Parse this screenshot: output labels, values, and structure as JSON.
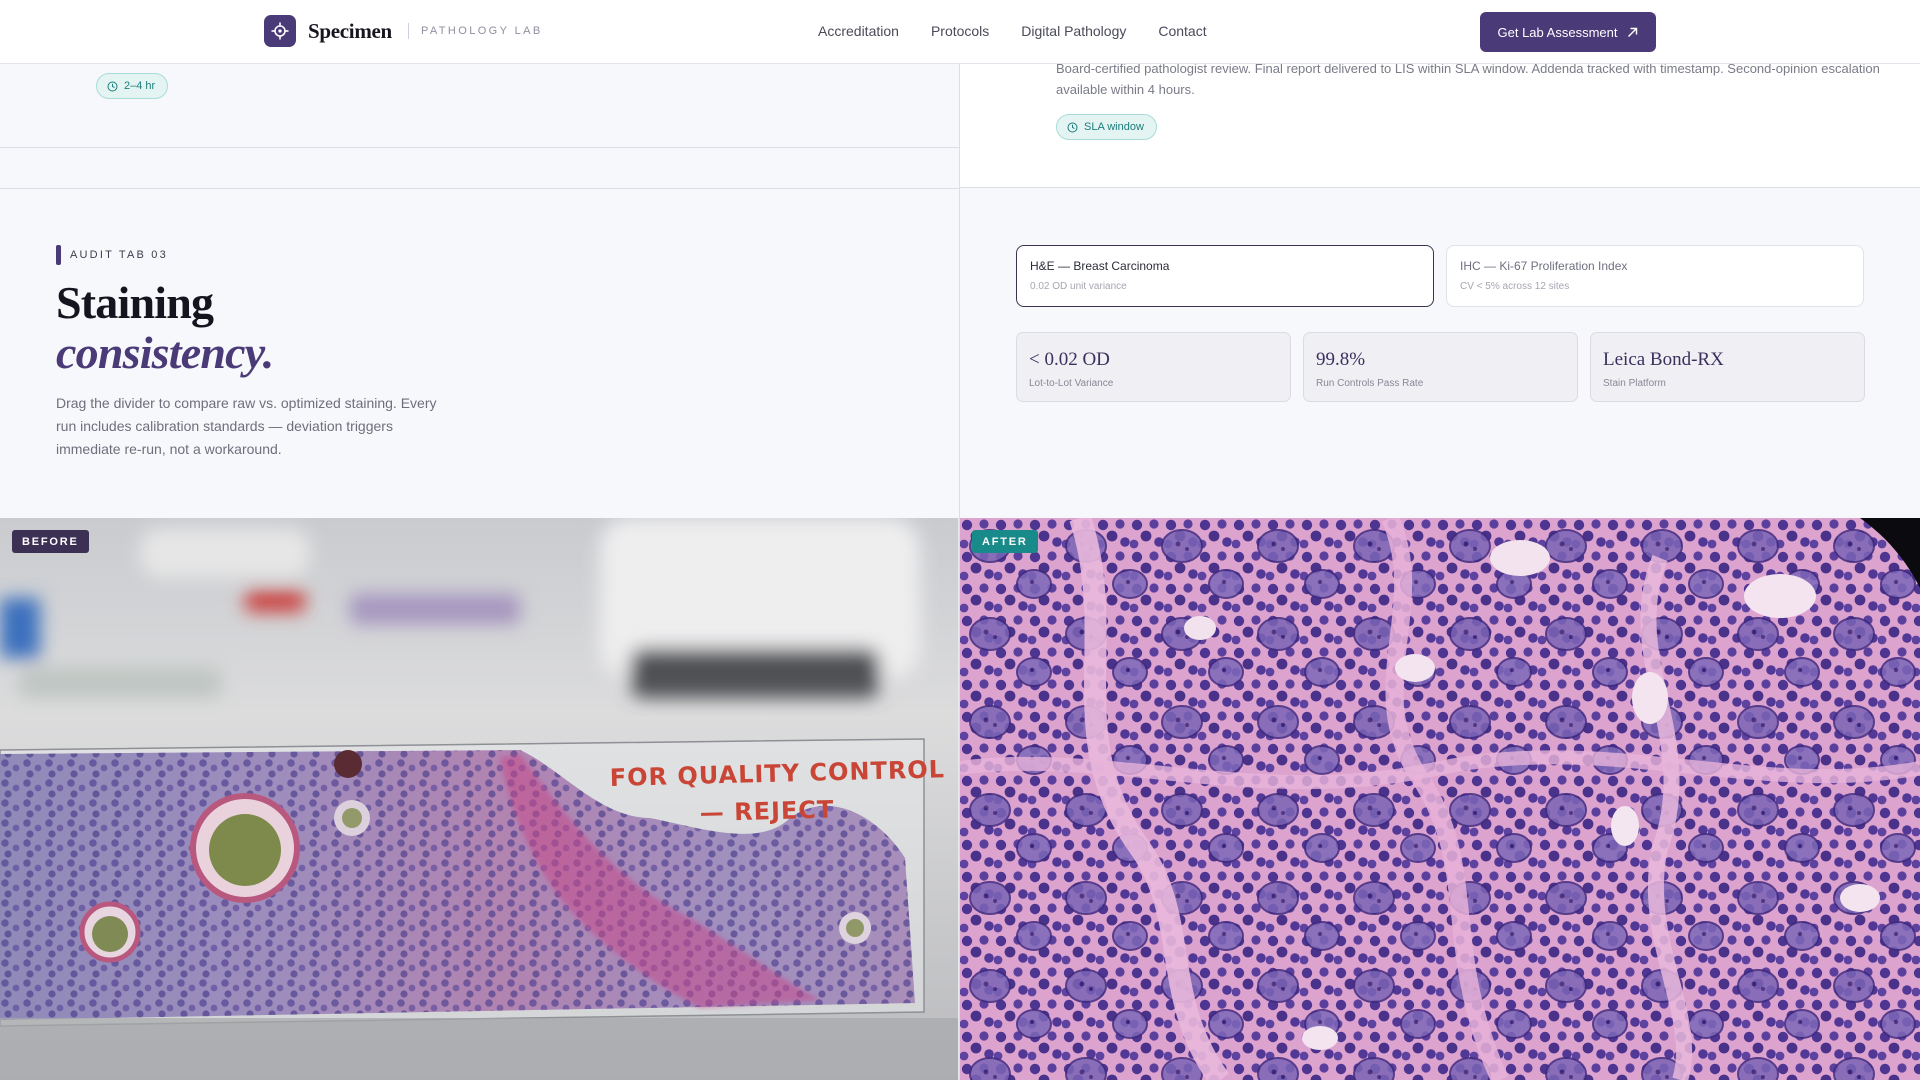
{
  "header": {
    "brand_name": "Specimen",
    "brand_sub": "PATHOLOGY LAB",
    "nav": [
      "Accreditation",
      "Protocols",
      "Digital Pathology",
      "Contact"
    ],
    "cta_label": "Get Lab Assessment"
  },
  "top": {
    "left_pill": "2–4 hr",
    "review_text": "Board-certified pathologist review. Final report delivered to LIS within SLA window. Addenda tracked with timestamp. Second-opinion escalation available within 4 hours.",
    "right_pill": "SLA window"
  },
  "section": {
    "eyebrow": "AUDIT TAB 03",
    "title_line1": "Staining",
    "title_line2": "consistency.",
    "description": "Drag the divider to compare raw vs. optimized staining. Every run includes calibration standards — deviation triggers immediate re-run, not a workaround."
  },
  "tabs": [
    {
      "title": "H&E — Breast Carcinoma",
      "sub": "0.02 OD unit variance",
      "active": true
    },
    {
      "title": "IHC — Ki-67 Proliferation Index",
      "sub": "CV < 5% across 12 sites",
      "active": false
    }
  ],
  "metrics": [
    {
      "value": "< 0.02 OD",
      "label": "Lot-to-Lot Variance"
    },
    {
      "value": "99.8%",
      "label": "Run Controls Pass Rate"
    },
    {
      "value": "Leica Bond-RX",
      "label": "Stain Platform"
    }
  ],
  "compare": {
    "before_label": "BEFORE",
    "after_label": "AFTER",
    "slide_note_line1": "FOR QUALITY CONTROL",
    "slide_note_line2": "— REJECT"
  },
  "colors": {
    "brand": "#4a3a78",
    "teal": "#198a8a",
    "text": "#1d1d29"
  }
}
